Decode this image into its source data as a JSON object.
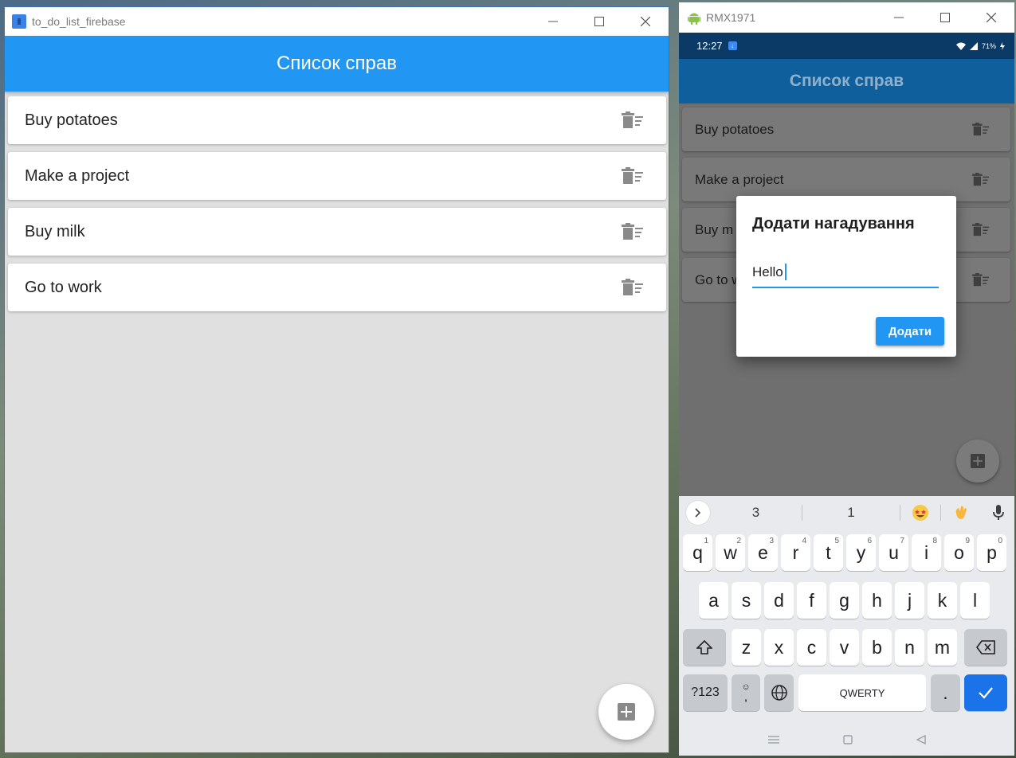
{
  "desktop": {
    "window_title": "to_do_list_firebase",
    "appbar_title": "Список справ",
    "todos": [
      "Buy potatoes",
      "Make a project",
      "Buy milk",
      "Go to work"
    ]
  },
  "emulator": {
    "window_title": "RMX1971",
    "statusbar": {
      "time": "12:27",
      "battery": "71%"
    },
    "appbar_title": "Список справ",
    "todos": [
      "Buy potatoes",
      "Make a project",
      "Buy m",
      "Go to w"
    ],
    "dialog": {
      "title": "Додати нагадування",
      "input_value": "Hello",
      "button_label": "Додати"
    },
    "keyboard": {
      "suggestions": [
        "3",
        "1"
      ],
      "emoji_suggestions": [
        "star-struck-emoji",
        "waving-hands-emoji"
      ],
      "row1": [
        [
          "q",
          "1"
        ],
        [
          "w",
          "2"
        ],
        [
          "e",
          "3"
        ],
        [
          "r",
          "4"
        ],
        [
          "t",
          "5"
        ],
        [
          "y",
          "6"
        ],
        [
          "u",
          "7"
        ],
        [
          "i",
          "8"
        ],
        [
          "o",
          "9"
        ],
        [
          "p",
          "0"
        ]
      ],
      "row2": [
        "a",
        "s",
        "d",
        "f",
        "g",
        "h",
        "j",
        "k",
        "l"
      ],
      "row3": [
        "z",
        "x",
        "c",
        "v",
        "b",
        "n",
        "m"
      ],
      "symbols_label": "?123",
      "emoji_key_label": ",",
      "space_label": "QWERTY",
      "period_label": "."
    }
  },
  "colors": {
    "primary": "#2196f3",
    "card": "#ffffff",
    "background": "#e0e0e0",
    "icon_grey": "#8a8a8a",
    "enter_key": "#1a73e8"
  }
}
